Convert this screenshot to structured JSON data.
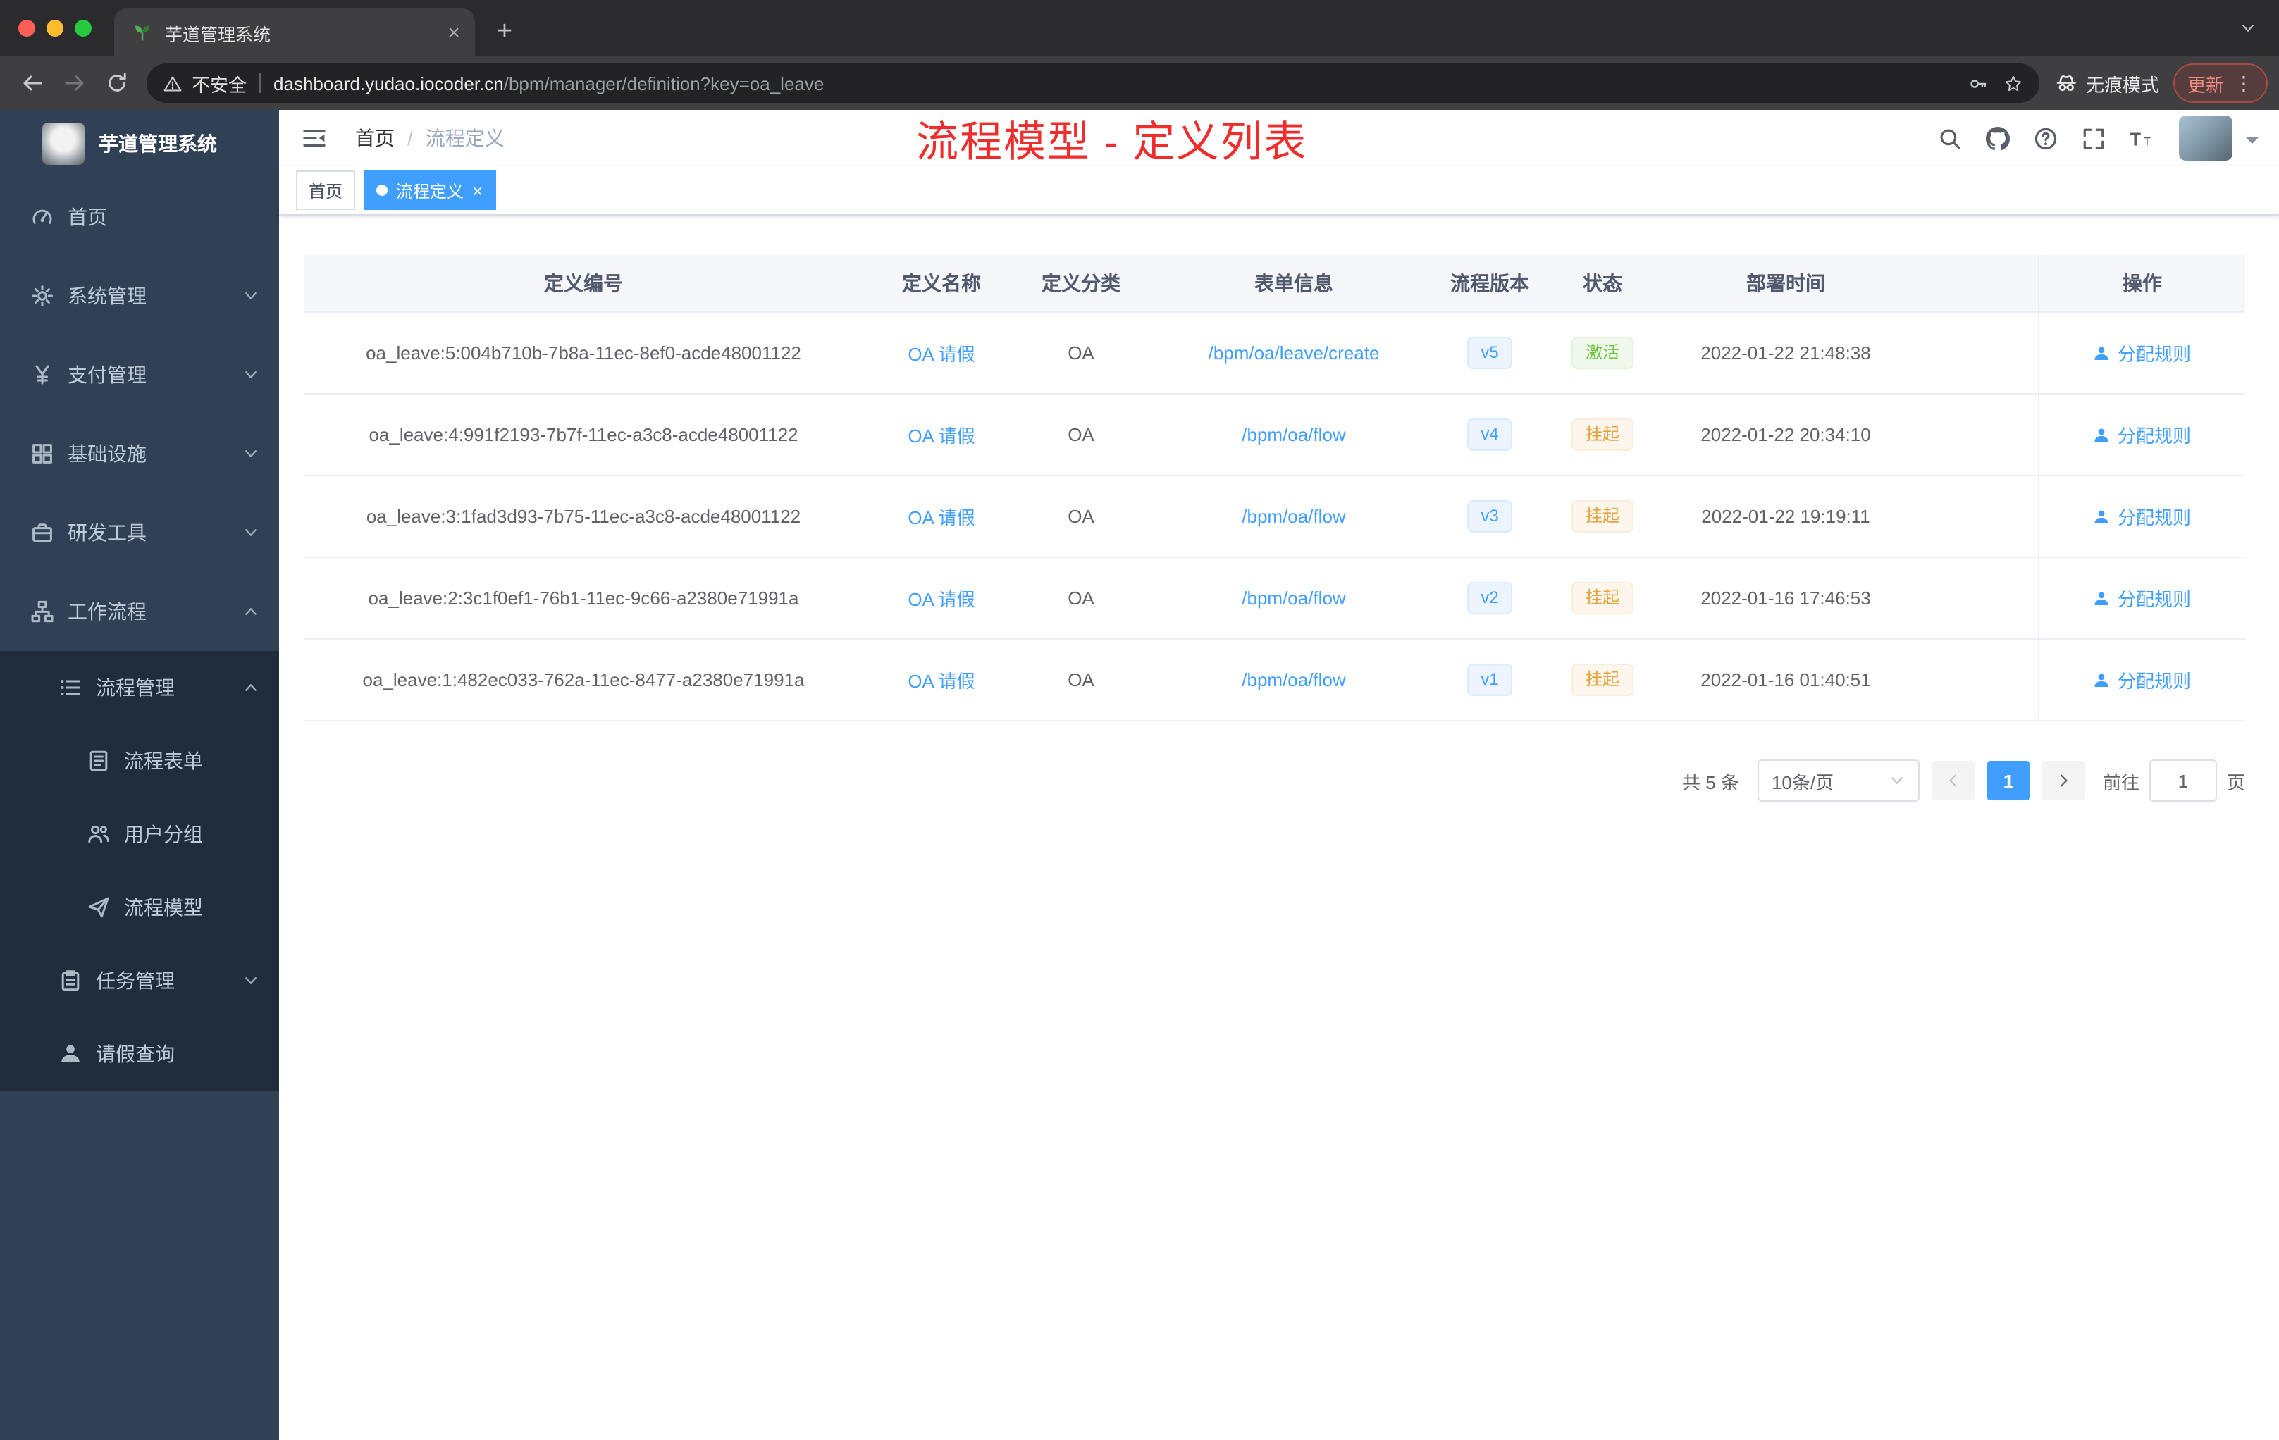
{
  "browser": {
    "tab": {
      "title": "芋道管理系统",
      "favicon": "leaf-icon",
      "close_label": "×",
      "new_tab_label": "+"
    },
    "traffic_lights": {
      "close": "#ff5f57",
      "minimize": "#febc2e",
      "zoom": "#28c840"
    },
    "security_label": "不安全",
    "url_host": "dashboard.yudao.iocoder.cn",
    "url_path": "/bpm/manager/definition?key=oa_leave",
    "incognito_label": "无痕模式",
    "update_label": "更新",
    "menu_dots": "⋮"
  },
  "sidebar": {
    "logo_title": "芋道管理系统",
    "items": [
      {
        "label": "首页",
        "icon": "dashboard-icon",
        "level": 0,
        "chevron": null,
        "dark": false
      },
      {
        "label": "系统管理",
        "icon": "gear-icon",
        "level": 0,
        "chevron": "down",
        "dark": false
      },
      {
        "label": "支付管理",
        "icon": "yen-icon",
        "level": 0,
        "chevron": "down",
        "dark": false
      },
      {
        "label": "基础设施",
        "icon": "grid-icon",
        "level": 0,
        "chevron": "down",
        "dark": false
      },
      {
        "label": "研发工具",
        "icon": "briefcase-icon",
        "level": 0,
        "chevron": "down",
        "dark": false
      },
      {
        "label": "工作流程",
        "icon": "workflow-icon",
        "level": 0,
        "chevron": "up",
        "dark": false
      },
      {
        "label": "流程管理",
        "icon": "list-icon",
        "level": 1,
        "chevron": "up",
        "dark": true
      },
      {
        "label": "流程表单",
        "icon": "form-icon",
        "level": 2,
        "chevron": null,
        "dark": true
      },
      {
        "label": "用户分组",
        "icon": "users-icon",
        "level": 2,
        "chevron": null,
        "dark": true
      },
      {
        "label": "流程模型",
        "icon": "send-icon",
        "level": 2,
        "chevron": null,
        "dark": true
      },
      {
        "label": "任务管理",
        "icon": "task-icon",
        "level": 1,
        "chevron": "down",
        "dark": true
      },
      {
        "label": "请假查询",
        "icon": "user-icon",
        "level": 1,
        "chevron": null,
        "dark": true
      }
    ]
  },
  "header": {
    "breadcrumb": {
      "first": "首页",
      "separator": "/",
      "last": "流程定义"
    },
    "annotation": "流程模型 - 定义列表",
    "annotation_color": "#f02d2d"
  },
  "tags": [
    {
      "label": "首页",
      "active": false,
      "closable": false
    },
    {
      "label": "流程定义",
      "active": true,
      "closable": true
    }
  ],
  "table": {
    "columns": [
      "定义编号",
      "定义名称",
      "定义分类",
      "表单信息",
      "流程版本",
      "状态",
      "部署时间",
      "操作"
    ],
    "rows": [
      {
        "id": "oa_leave:5:004b710b-7b8a-11ec-8ef0-acde48001122",
        "name": "OA 请假",
        "category": "OA",
        "form": "/bpm/oa/leave/create",
        "version": "v5",
        "status": "激活",
        "status_type": "success",
        "time": "2022-01-22 21:48:38",
        "action": "分配规则"
      },
      {
        "id": "oa_leave:4:991f2193-7b7f-11ec-a3c8-acde48001122",
        "name": "OA 请假",
        "category": "OA",
        "form": "/bpm/oa/flow",
        "version": "v4",
        "status": "挂起",
        "status_type": "warning",
        "time": "2022-01-22 20:34:10",
        "action": "分配规则"
      },
      {
        "id": "oa_leave:3:1fad3d93-7b75-11ec-a3c8-acde48001122",
        "name": "OA 请假",
        "category": "OA",
        "form": "/bpm/oa/flow",
        "version": "v3",
        "status": "挂起",
        "status_type": "warning",
        "time": "2022-01-22 19:19:11",
        "action": "分配规则"
      },
      {
        "id": "oa_leave:2:3c1f0ef1-76b1-11ec-9c66-a2380e71991a",
        "name": "OA 请假",
        "category": "OA",
        "form": "/bpm/oa/flow",
        "version": "v2",
        "status": "挂起",
        "status_type": "warning",
        "time": "2022-01-16 17:46:53",
        "action": "分配规则"
      },
      {
        "id": "oa_leave:1:482ec033-762a-11ec-8477-a2380e71991a",
        "name": "OA 请假",
        "category": "OA",
        "form": "/bpm/oa/flow",
        "version": "v1",
        "status": "挂起",
        "status_type": "warning",
        "time": "2022-01-16 01:40:51",
        "action": "分配规则"
      }
    ]
  },
  "pagination": {
    "total": "共 5 条",
    "page_size": "10条/页",
    "current_page": "1",
    "goto_label": "前往",
    "goto_value": "1",
    "unit_label": "页"
  },
  "colors": {
    "accent": "#409eff",
    "success": "#67c23a",
    "warning": "#e6a23c",
    "sidebar_bg": "#304156",
    "submenu_bg": "#1f2d3d"
  }
}
